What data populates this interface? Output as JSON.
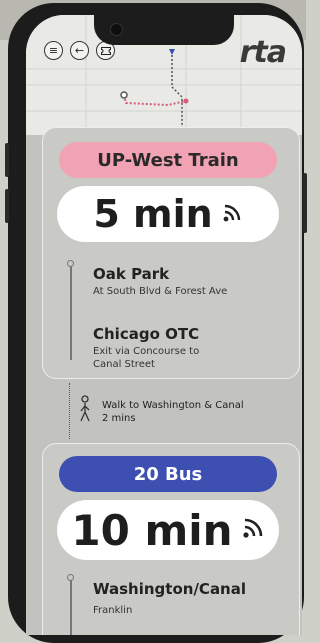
{
  "toolbar": {
    "menu_icon": "≡",
    "back_icon": "←",
    "ticket_icon": "ticket-icon"
  },
  "brand": {
    "logo": "rta"
  },
  "train": {
    "route_label": "UP-West Train",
    "route_color": "#f2a3b3",
    "arrival": "5 min",
    "stops": [
      {
        "name": "Oak Park",
        "detail": "At South Blvd & Forest Ave"
      },
      {
        "name": "Chicago OTC",
        "detail": "Exit via Concourse to Canal Street"
      }
    ]
  },
  "walk": {
    "text": "Walk to Washington & Canal",
    "duration": "2 mins"
  },
  "bus": {
    "route_label": "20 Bus",
    "route_color": "#3d4fb0",
    "arrival": "10 min",
    "stops": [
      {
        "name": "Washington/Canal",
        "detail": "Franklin"
      }
    ]
  },
  "colors": {
    "accent_pink": "#f2a3b3",
    "accent_blue": "#3d4fb0",
    "map_route_pink": "#d65d7a"
  }
}
